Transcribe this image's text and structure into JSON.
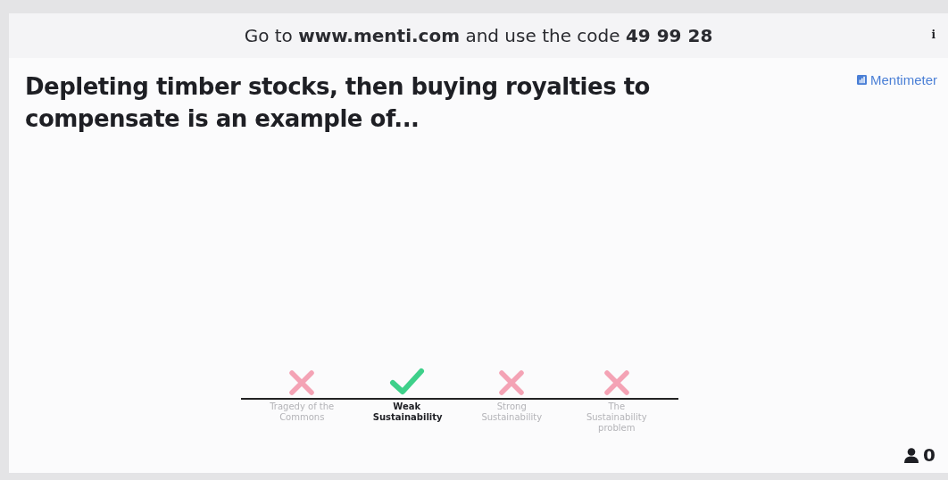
{
  "header": {
    "instruction": "Go to **www.menti.com** and use the code **49 99 28**",
    "info": "i"
  },
  "brand": {
    "name": "Mentimeter"
  },
  "question": "Depleting timber stocks, then buying royalties to compensate is an example of...",
  "options": [
    {
      "label": "Tragedy of the Commons",
      "correct": false
    },
    {
      "label": "Weak Sustainability",
      "correct": true
    },
    {
      "label": "Strong Sustainability",
      "correct": false
    },
    {
      "label": "The Sustainability problem",
      "correct": false
    }
  ],
  "participants": {
    "count": "0"
  }
}
